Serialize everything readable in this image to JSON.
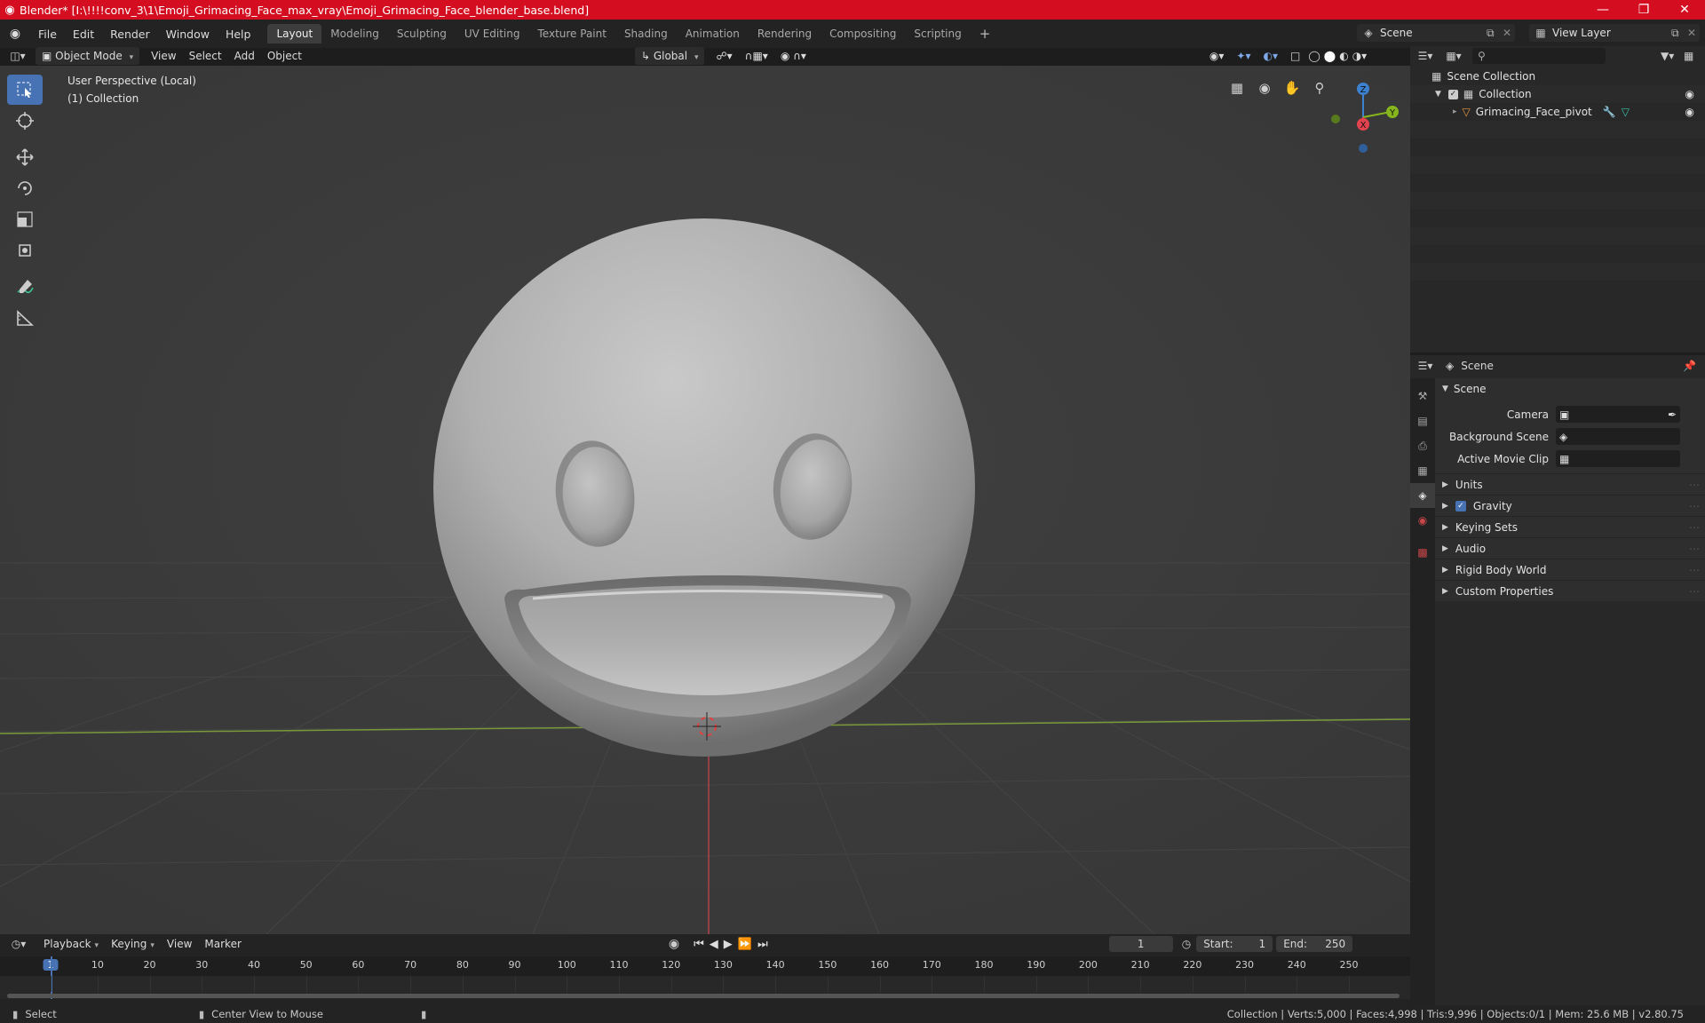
{
  "window": {
    "title": "Blender* [I:\\!!!!conv_3\\1\\Emoji_Grimacing_Face_max_vray\\Emoji_Grimacing_Face_blender_base.blend]",
    "minimize": "—",
    "maximize": "❐",
    "close": "✕"
  },
  "menu": {
    "items": [
      "File",
      "Edit",
      "Render",
      "Window",
      "Help"
    ]
  },
  "workspaces": {
    "tabs": [
      "Layout",
      "Modeling",
      "Sculpting",
      "UV Editing",
      "Texture Paint",
      "Shading",
      "Animation",
      "Rendering",
      "Compositing",
      "Scripting"
    ],
    "active": "Layout",
    "add": "+"
  },
  "top_right": {
    "scene": "Scene",
    "view_layer": "View Layer"
  },
  "viewport_header": {
    "mode": "Object Mode",
    "view": "View",
    "select": "Select",
    "add": "Add",
    "object": "Object",
    "transform_orientation": "Global"
  },
  "viewport": {
    "perspective": "User Perspective (Local)",
    "collection": "(1) Collection",
    "gizmo": {
      "z": "Z",
      "y": "Y",
      "x": "X"
    }
  },
  "outliner": {
    "rows": [
      {
        "label": "Scene Collection"
      },
      {
        "label": "Collection"
      },
      {
        "label": "Grimacing_Face_pivot"
      }
    ]
  },
  "properties": {
    "context": "Scene",
    "panel_title": "Scene",
    "fields": [
      {
        "label": "Camera"
      },
      {
        "label": "Background Scene"
      },
      {
        "label": "Active Movie Clip"
      }
    ],
    "subpanels": [
      "Units",
      "Gravity",
      "Keying Sets",
      "Audio",
      "Rigid Body World",
      "Custom Properties"
    ],
    "gravity_checked": true
  },
  "timeline": {
    "menus": [
      "Playback",
      "Keying",
      "View",
      "Marker"
    ],
    "current_frame": "1",
    "start_label": "Start:",
    "start": "1",
    "end_label": "End:",
    "end": "250",
    "ticks": [
      1,
      10,
      20,
      30,
      40,
      50,
      60,
      70,
      80,
      90,
      100,
      110,
      120,
      130,
      140,
      150,
      160,
      170,
      180,
      190,
      200,
      210,
      220,
      230,
      240,
      250
    ],
    "playhead_label": "1"
  },
  "status": {
    "select": "Select",
    "center_view": "Center View to Mouse",
    "stats": "Collection | Verts:5,000 | Faces:4,998 | Tris:9,996 | Objects:0/1 | Mem: 25.6 MB | v2.80.75"
  },
  "colors": {
    "titlebar": "#d40e20",
    "accent": "#4772b3",
    "x_axis": "#e2434f",
    "y_axis": "#86b61b",
    "z_axis": "#3d82d1",
    "viewport_bg": "#393939"
  }
}
